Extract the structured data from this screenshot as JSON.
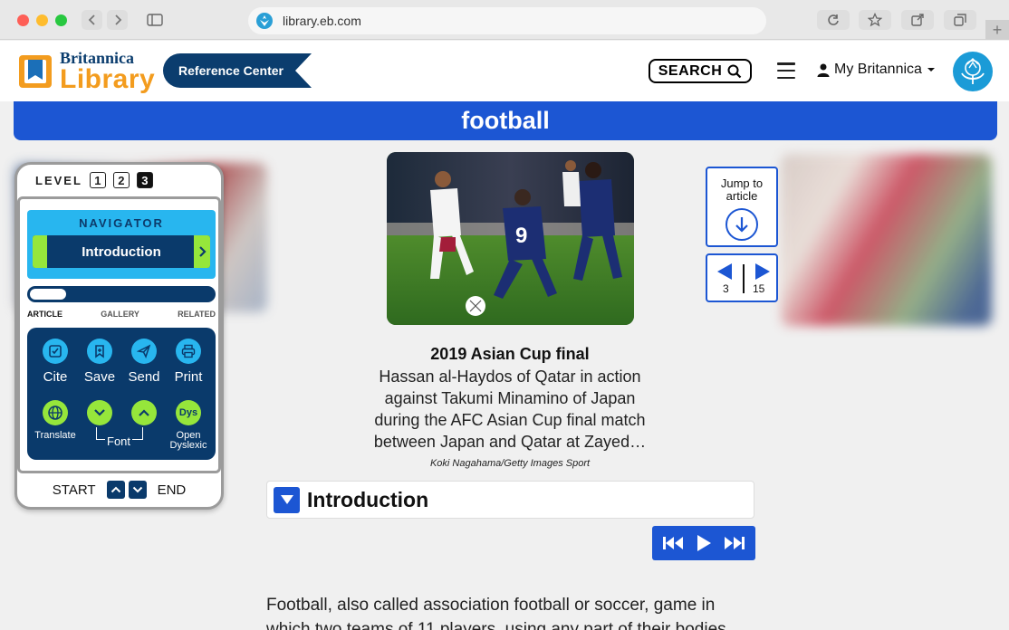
{
  "browser": {
    "url": "library.eb.com",
    "new_tab_label": "+"
  },
  "header": {
    "logo_top": "Britannica",
    "logo_bottom": "Library",
    "badge": "Reference Center",
    "search_label": "SEARCH",
    "account_label": "My Britannica"
  },
  "article": {
    "title": "football",
    "image_alt": "Football players competing in the 2019 Asian Cup final",
    "caption_title": "2019 Asian Cup final",
    "caption_body": "Hassan al-Haydos of Qatar in action against Takumi Minamino of Japan during the AFC Asian Cup final match between Japan and Qatar at Zayed…",
    "caption_credit": "Koki Nagahama/Getty Images Sport",
    "section_title": "Introduction",
    "body": "Football, also called association football or soccer, game in which two teams of 11 players, using any part of their bodies"
  },
  "navigator": {
    "level_label": "LEVEL",
    "levels": [
      "1",
      "2",
      "3"
    ],
    "active_level": "3",
    "navigator_label": "NAVIGATOR",
    "current_section": "Introduction",
    "progress_fraction": 0.2,
    "tabs": [
      "ARTICLE",
      "GALLERY",
      "RELATED"
    ],
    "tools": {
      "cite": "Cite",
      "save": "Save",
      "send": "Send",
      "print": "Print",
      "translate": "Translate",
      "font": "Font",
      "dyslexic_icon": "Dys",
      "dyslexic_line1": "Open",
      "dyslexic_line2": "Dyslexic"
    },
    "start_label": "START",
    "end_label": "END"
  },
  "jump": {
    "line1": "Jump to",
    "line2": "article"
  },
  "pager": {
    "current": "3",
    "total": "15"
  },
  "colors": {
    "brand_blue": "#1c56d3",
    "navy": "#0a3a6b",
    "cyan": "#28b6ef",
    "lime": "#96e63b",
    "logo_orange": "#f39c1e"
  }
}
